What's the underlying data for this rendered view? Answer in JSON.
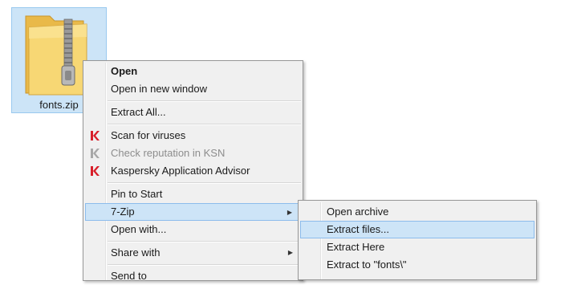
{
  "desktop": {
    "file_name": "fonts.zip",
    "file_icon": "zip-folder-icon"
  },
  "context_menu": {
    "open": "Open",
    "open_new_window": "Open in new window",
    "extract_all": "Extract All...",
    "scan_viruses": "Scan for viruses",
    "check_reputation": "Check reputation in KSN",
    "app_advisor": "Kaspersky Application Advisor",
    "pin_to_start": "Pin to Start",
    "seven_zip": "7-Zip",
    "open_with": "Open with...",
    "share_with": "Share with",
    "send_to": "Send to"
  },
  "seven_zip_menu": {
    "open_archive": "Open archive",
    "extract_files": "Extract files...",
    "extract_here": "Extract Here",
    "extract_to": "Extract to \"fonts\\\""
  },
  "colors": {
    "highlight": "#cde4f7",
    "highlight_border": "#8cbcec",
    "menu_bg": "#f0f0f0",
    "kaspersky_red": "#d81f2a",
    "disabled_text": "#8d8d8d"
  }
}
